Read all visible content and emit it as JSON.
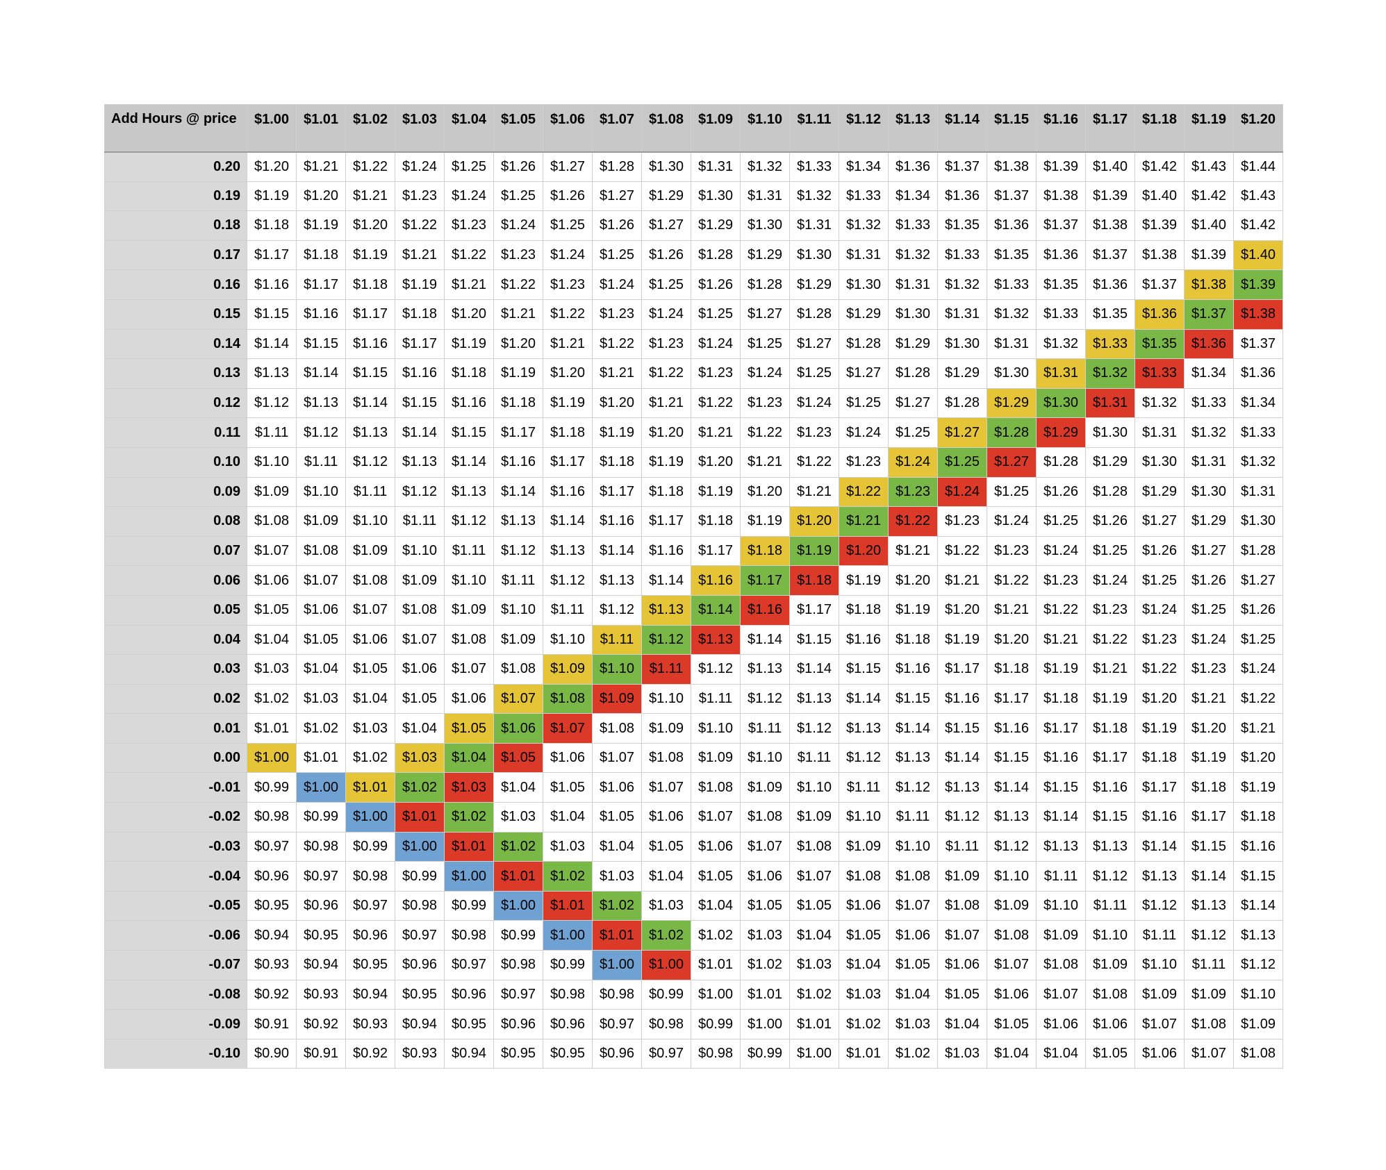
{
  "header": {
    "corner_label": "Add Hours @ price",
    "columns": [
      "$1.00",
      "$1.01",
      "$1.02",
      "$1.03",
      "$1.04",
      "$1.05",
      "$1.06",
      "$1.07",
      "$1.08",
      "$1.09",
      "$1.10",
      "$1.11",
      "$1.12",
      "$1.13",
      "$1.14",
      "$1.15",
      "$1.16",
      "$1.17",
      "$1.18",
      "$1.19",
      "$1.20"
    ]
  },
  "colors": {
    "y": "#e5c437",
    "g": "#79b747",
    "r": "#dc3a28",
    "b": "#6fa2d2"
  },
  "rows": [
    {
      "label": "0.20",
      "cells": [
        "$1.20",
        "$1.21",
        "$1.22",
        "$1.24",
        "$1.25",
        "$1.26",
        "$1.27",
        "$1.28",
        "$1.30",
        "$1.31",
        "$1.32",
        "$1.33",
        "$1.34",
        "$1.36",
        "$1.37",
        "$1.38",
        "$1.39",
        "$1.40",
        "$1.42",
        "$1.43",
        "$1.44"
      ],
      "hl": []
    },
    {
      "label": "0.19",
      "cells": [
        "$1.19",
        "$1.20",
        "$1.21",
        "$1.23",
        "$1.24",
        "$1.25",
        "$1.26",
        "$1.27",
        "$1.29",
        "$1.30",
        "$1.31",
        "$1.32",
        "$1.33",
        "$1.34",
        "$1.36",
        "$1.37",
        "$1.38",
        "$1.39",
        "$1.40",
        "$1.42",
        "$1.43"
      ],
      "hl": []
    },
    {
      "label": "0.18",
      "cells": [
        "$1.18",
        "$1.19",
        "$1.20",
        "$1.22",
        "$1.23",
        "$1.24",
        "$1.25",
        "$1.26",
        "$1.27",
        "$1.29",
        "$1.30",
        "$1.31",
        "$1.32",
        "$1.33",
        "$1.35",
        "$1.36",
        "$1.37",
        "$1.38",
        "$1.39",
        "$1.40",
        "$1.42"
      ],
      "hl": []
    },
    {
      "label": "0.17",
      "cells": [
        "$1.17",
        "$1.18",
        "$1.19",
        "$1.21",
        "$1.22",
        "$1.23",
        "$1.24",
        "$1.25",
        "$1.26",
        "$1.28",
        "$1.29",
        "$1.30",
        "$1.31",
        "$1.32",
        "$1.33",
        "$1.35",
        "$1.36",
        "$1.37",
        "$1.38",
        "$1.39",
        "$1.40"
      ],
      "hl": [
        [
          20,
          "y"
        ]
      ]
    },
    {
      "label": "0.16",
      "cells": [
        "$1.16",
        "$1.17",
        "$1.18",
        "$1.19",
        "$1.21",
        "$1.22",
        "$1.23",
        "$1.24",
        "$1.25",
        "$1.26",
        "$1.28",
        "$1.29",
        "$1.30",
        "$1.31",
        "$1.32",
        "$1.33",
        "$1.35",
        "$1.36",
        "$1.37",
        "$1.38",
        "$1.39"
      ],
      "hl": [
        [
          19,
          "y"
        ],
        [
          20,
          "g"
        ]
      ]
    },
    {
      "label": "0.15",
      "cells": [
        "$1.15",
        "$1.16",
        "$1.17",
        "$1.18",
        "$1.20",
        "$1.21",
        "$1.22",
        "$1.23",
        "$1.24",
        "$1.25",
        "$1.27",
        "$1.28",
        "$1.29",
        "$1.30",
        "$1.31",
        "$1.32",
        "$1.33",
        "$1.35",
        "$1.36",
        "$1.37",
        "$1.38"
      ],
      "hl": [
        [
          18,
          "y"
        ],
        [
          19,
          "g"
        ],
        [
          20,
          "r"
        ]
      ]
    },
    {
      "label": "0.14",
      "cells": [
        "$1.14",
        "$1.15",
        "$1.16",
        "$1.17",
        "$1.19",
        "$1.20",
        "$1.21",
        "$1.22",
        "$1.23",
        "$1.24",
        "$1.25",
        "$1.27",
        "$1.28",
        "$1.29",
        "$1.30",
        "$1.31",
        "$1.32",
        "$1.33",
        "$1.35",
        "$1.36",
        "$1.37"
      ],
      "hl": [
        [
          17,
          "y"
        ],
        [
          18,
          "g"
        ],
        [
          19,
          "r"
        ]
      ]
    },
    {
      "label": "0.13",
      "cells": [
        "$1.13",
        "$1.14",
        "$1.15",
        "$1.16",
        "$1.18",
        "$1.19",
        "$1.20",
        "$1.21",
        "$1.22",
        "$1.23",
        "$1.24",
        "$1.25",
        "$1.27",
        "$1.28",
        "$1.29",
        "$1.30",
        "$1.31",
        "$1.32",
        "$1.33",
        "$1.34",
        "$1.36"
      ],
      "hl": [
        [
          16,
          "y"
        ],
        [
          17,
          "g"
        ],
        [
          18,
          "r"
        ]
      ]
    },
    {
      "label": "0.12",
      "cells": [
        "$1.12",
        "$1.13",
        "$1.14",
        "$1.15",
        "$1.16",
        "$1.18",
        "$1.19",
        "$1.20",
        "$1.21",
        "$1.22",
        "$1.23",
        "$1.24",
        "$1.25",
        "$1.27",
        "$1.28",
        "$1.29",
        "$1.30",
        "$1.31",
        "$1.32",
        "$1.33",
        "$1.34"
      ],
      "hl": [
        [
          15,
          "y"
        ],
        [
          16,
          "g"
        ],
        [
          17,
          "r"
        ]
      ]
    },
    {
      "label": "0.11",
      "cells": [
        "$1.11",
        "$1.12",
        "$1.13",
        "$1.14",
        "$1.15",
        "$1.17",
        "$1.18",
        "$1.19",
        "$1.20",
        "$1.21",
        "$1.22",
        "$1.23",
        "$1.24",
        "$1.25",
        "$1.27",
        "$1.28",
        "$1.29",
        "$1.30",
        "$1.31",
        "$1.32",
        "$1.33"
      ],
      "hl": [
        [
          14,
          "y"
        ],
        [
          15,
          "g"
        ],
        [
          16,
          "r"
        ]
      ]
    },
    {
      "label": "0.10",
      "cells": [
        "$1.10",
        "$1.11",
        "$1.12",
        "$1.13",
        "$1.14",
        "$1.16",
        "$1.17",
        "$1.18",
        "$1.19",
        "$1.20",
        "$1.21",
        "$1.22",
        "$1.23",
        "$1.24",
        "$1.25",
        "$1.27",
        "$1.28",
        "$1.29",
        "$1.30",
        "$1.31",
        "$1.32"
      ],
      "hl": [
        [
          13,
          "y"
        ],
        [
          14,
          "g"
        ],
        [
          15,
          "r"
        ]
      ]
    },
    {
      "label": "0.09",
      "cells": [
        "$1.09",
        "$1.10",
        "$1.11",
        "$1.12",
        "$1.13",
        "$1.14",
        "$1.16",
        "$1.17",
        "$1.18",
        "$1.19",
        "$1.20",
        "$1.21",
        "$1.22",
        "$1.23",
        "$1.24",
        "$1.25",
        "$1.26",
        "$1.28",
        "$1.29",
        "$1.30",
        "$1.31"
      ],
      "hl": [
        [
          12,
          "y"
        ],
        [
          13,
          "g"
        ],
        [
          14,
          "r"
        ]
      ]
    },
    {
      "label": "0.08",
      "cells": [
        "$1.08",
        "$1.09",
        "$1.10",
        "$1.11",
        "$1.12",
        "$1.13",
        "$1.14",
        "$1.16",
        "$1.17",
        "$1.18",
        "$1.19",
        "$1.20",
        "$1.21",
        "$1.22",
        "$1.23",
        "$1.24",
        "$1.25",
        "$1.26",
        "$1.27",
        "$1.29",
        "$1.30"
      ],
      "hl": [
        [
          11,
          "y"
        ],
        [
          12,
          "g"
        ],
        [
          13,
          "r"
        ]
      ]
    },
    {
      "label": "0.07",
      "cells": [
        "$1.07",
        "$1.08",
        "$1.09",
        "$1.10",
        "$1.11",
        "$1.12",
        "$1.13",
        "$1.14",
        "$1.16",
        "$1.17",
        "$1.18",
        "$1.19",
        "$1.20",
        "$1.21",
        "$1.22",
        "$1.23",
        "$1.24",
        "$1.25",
        "$1.26",
        "$1.27",
        "$1.28"
      ],
      "hl": [
        [
          10,
          "y"
        ],
        [
          11,
          "g"
        ],
        [
          12,
          "r"
        ]
      ]
    },
    {
      "label": "0.06",
      "cells": [
        "$1.06",
        "$1.07",
        "$1.08",
        "$1.09",
        "$1.10",
        "$1.11",
        "$1.12",
        "$1.13",
        "$1.14",
        "$1.16",
        "$1.17",
        "$1.18",
        "$1.19",
        "$1.20",
        "$1.21",
        "$1.22",
        "$1.23",
        "$1.24",
        "$1.25",
        "$1.26",
        "$1.27"
      ],
      "hl": [
        [
          9,
          "y"
        ],
        [
          10,
          "g"
        ],
        [
          11,
          "r"
        ]
      ]
    },
    {
      "label": "0.05",
      "cells": [
        "$1.05",
        "$1.06",
        "$1.07",
        "$1.08",
        "$1.09",
        "$1.10",
        "$1.11",
        "$1.12",
        "$1.13",
        "$1.14",
        "$1.16",
        "$1.17",
        "$1.18",
        "$1.19",
        "$1.20",
        "$1.21",
        "$1.22",
        "$1.23",
        "$1.24",
        "$1.25",
        "$1.26"
      ],
      "hl": [
        [
          8,
          "y"
        ],
        [
          9,
          "g"
        ],
        [
          10,
          "r"
        ]
      ]
    },
    {
      "label": "0.04",
      "cells": [
        "$1.04",
        "$1.05",
        "$1.06",
        "$1.07",
        "$1.08",
        "$1.09",
        "$1.10",
        "$1.11",
        "$1.12",
        "$1.13",
        "$1.14",
        "$1.15",
        "$1.16",
        "$1.18",
        "$1.19",
        "$1.20",
        "$1.21",
        "$1.22",
        "$1.23",
        "$1.24",
        "$1.25"
      ],
      "hl": [
        [
          7,
          "y"
        ],
        [
          8,
          "g"
        ],
        [
          9,
          "r"
        ]
      ]
    },
    {
      "label": "0.03",
      "cells": [
        "$1.03",
        "$1.04",
        "$1.05",
        "$1.06",
        "$1.07",
        "$1.08",
        "$1.09",
        "$1.10",
        "$1.11",
        "$1.12",
        "$1.13",
        "$1.14",
        "$1.15",
        "$1.16",
        "$1.17",
        "$1.18",
        "$1.19",
        "$1.21",
        "$1.22",
        "$1.23",
        "$1.24"
      ],
      "hl": [
        [
          6,
          "y"
        ],
        [
          7,
          "g"
        ],
        [
          8,
          "r"
        ]
      ]
    },
    {
      "label": "0.02",
      "cells": [
        "$1.02",
        "$1.03",
        "$1.04",
        "$1.05",
        "$1.06",
        "$1.07",
        "$1.08",
        "$1.09",
        "$1.10",
        "$1.11",
        "$1.12",
        "$1.13",
        "$1.14",
        "$1.15",
        "$1.16",
        "$1.17",
        "$1.18",
        "$1.19",
        "$1.20",
        "$1.21",
        "$1.22"
      ],
      "hl": [
        [
          5,
          "y"
        ],
        [
          6,
          "g"
        ],
        [
          7,
          "r"
        ]
      ]
    },
    {
      "label": "0.01",
      "cells": [
        "$1.01",
        "$1.02",
        "$1.03",
        "$1.04",
        "$1.05",
        "$1.06",
        "$1.07",
        "$1.08",
        "$1.09",
        "$1.10",
        "$1.11",
        "$1.12",
        "$1.13",
        "$1.14",
        "$1.15",
        "$1.16",
        "$1.17",
        "$1.18",
        "$1.19",
        "$1.20",
        "$1.21"
      ],
      "hl": [
        [
          4,
          "y"
        ],
        [
          5,
          "g"
        ],
        [
          6,
          "r"
        ]
      ]
    },
    {
      "label": "0.00",
      "cells": [
        "$1.00",
        "$1.01",
        "$1.02",
        "$1.03",
        "$1.04",
        "$1.05",
        "$1.06",
        "$1.07",
        "$1.08",
        "$1.09",
        "$1.10",
        "$1.11",
        "$1.12",
        "$1.13",
        "$1.14",
        "$1.15",
        "$1.16",
        "$1.17",
        "$1.18",
        "$1.19",
        "$1.20"
      ],
      "hl": [
        [
          0,
          "y"
        ],
        [
          3,
          "y"
        ],
        [
          4,
          "g"
        ],
        [
          5,
          "r"
        ]
      ]
    },
    {
      "label": "-0.01",
      "cells": [
        "$0.99",
        "$1.00",
        "$1.01",
        "$1.02",
        "$1.03",
        "$1.04",
        "$1.05",
        "$1.06",
        "$1.07",
        "$1.08",
        "$1.09",
        "$1.10",
        "$1.11",
        "$1.12",
        "$1.13",
        "$1.14",
        "$1.15",
        "$1.16",
        "$1.17",
        "$1.18",
        "$1.19"
      ],
      "hl": [
        [
          1,
          "b"
        ],
        [
          2,
          "y"
        ],
        [
          3,
          "g"
        ],
        [
          4,
          "r"
        ]
      ]
    },
    {
      "label": "-0.02",
      "cells": [
        "$0.98",
        "$0.99",
        "$1.00",
        "$1.01",
        "$1.02",
        "$1.03",
        "$1.04",
        "$1.05",
        "$1.06",
        "$1.07",
        "$1.08",
        "$1.09",
        "$1.10",
        "$1.11",
        "$1.12",
        "$1.13",
        "$1.14",
        "$1.15",
        "$1.16",
        "$1.17",
        "$1.18"
      ],
      "hl": [
        [
          2,
          "b"
        ],
        [
          3,
          "r"
        ],
        [
          4,
          "g"
        ]
      ]
    },
    {
      "label": "-0.03",
      "cells": [
        "$0.97",
        "$0.98",
        "$0.99",
        "$1.00",
        "$1.01",
        "$1.02",
        "$1.03",
        "$1.04",
        "$1.05",
        "$1.06",
        "$1.07",
        "$1.08",
        "$1.09",
        "$1.10",
        "$1.11",
        "$1.12",
        "$1.13",
        "$1.13",
        "$1.14",
        "$1.15",
        "$1.16"
      ],
      "hl": [
        [
          3,
          "b"
        ],
        [
          4,
          "r"
        ],
        [
          5,
          "g"
        ]
      ]
    },
    {
      "label": "-0.04",
      "cells": [
        "$0.96",
        "$0.97",
        "$0.98",
        "$0.99",
        "$1.00",
        "$1.01",
        "$1.02",
        "$1.03",
        "$1.04",
        "$1.05",
        "$1.06",
        "$1.07",
        "$1.08",
        "$1.08",
        "$1.09",
        "$1.10",
        "$1.11",
        "$1.12",
        "$1.13",
        "$1.14",
        "$1.15"
      ],
      "hl": [
        [
          4,
          "b"
        ],
        [
          5,
          "r"
        ],
        [
          6,
          "g"
        ]
      ]
    },
    {
      "label": "-0.05",
      "cells": [
        "$0.95",
        "$0.96",
        "$0.97",
        "$0.98",
        "$0.99",
        "$1.00",
        "$1.01",
        "$1.02",
        "$1.03",
        "$1.04",
        "$1.05",
        "$1.05",
        "$1.06",
        "$1.07",
        "$1.08",
        "$1.09",
        "$1.10",
        "$1.11",
        "$1.12",
        "$1.13",
        "$1.14"
      ],
      "hl": [
        [
          5,
          "b"
        ],
        [
          6,
          "r"
        ],
        [
          7,
          "g"
        ]
      ]
    },
    {
      "label": "-0.06",
      "cells": [
        "$0.94",
        "$0.95",
        "$0.96",
        "$0.97",
        "$0.98",
        "$0.99",
        "$1.00",
        "$1.01",
        "$1.02",
        "$1.02",
        "$1.03",
        "$1.04",
        "$1.05",
        "$1.06",
        "$1.07",
        "$1.08",
        "$1.09",
        "$1.10",
        "$1.11",
        "$1.12",
        "$1.13"
      ],
      "hl": [
        [
          6,
          "b"
        ],
        [
          7,
          "r"
        ],
        [
          8,
          "g"
        ]
      ]
    },
    {
      "label": "-0.07",
      "cells": [
        "$0.93",
        "$0.94",
        "$0.95",
        "$0.96",
        "$0.97",
        "$0.98",
        "$0.99",
        "$1.00",
        "$1.00",
        "$1.01",
        "$1.02",
        "$1.03",
        "$1.04",
        "$1.05",
        "$1.06",
        "$1.07",
        "$1.08",
        "$1.09",
        "$1.10",
        "$1.11",
        "$1.12"
      ],
      "hl": [
        [
          7,
          "b"
        ],
        [
          8,
          "r"
        ]
      ]
    },
    {
      "label": "-0.08",
      "cells": [
        "$0.92",
        "$0.93",
        "$0.94",
        "$0.95",
        "$0.96",
        "$0.97",
        "$0.98",
        "$0.98",
        "$0.99",
        "$1.00",
        "$1.01",
        "$1.02",
        "$1.03",
        "$1.04",
        "$1.05",
        "$1.06",
        "$1.07",
        "$1.08",
        "$1.09",
        "$1.09",
        "$1.10"
      ],
      "hl": []
    },
    {
      "label": "-0.09",
      "cells": [
        "$0.91",
        "$0.92",
        "$0.93",
        "$0.94",
        "$0.95",
        "$0.96",
        "$0.96",
        "$0.97",
        "$0.98",
        "$0.99",
        "$1.00",
        "$1.01",
        "$1.02",
        "$1.03",
        "$1.04",
        "$1.05",
        "$1.06",
        "$1.06",
        "$1.07",
        "$1.08",
        "$1.09"
      ],
      "hl": []
    },
    {
      "label": "-0.10",
      "cells": [
        "$0.90",
        "$0.91",
        "$0.92",
        "$0.93",
        "$0.94",
        "$0.95",
        "$0.95",
        "$0.96",
        "$0.97",
        "$0.98",
        "$0.99",
        "$1.00",
        "$1.01",
        "$1.02",
        "$1.03",
        "$1.04",
        "$1.04",
        "$1.05",
        "$1.06",
        "$1.07",
        "$1.08"
      ],
      "hl": []
    }
  ]
}
